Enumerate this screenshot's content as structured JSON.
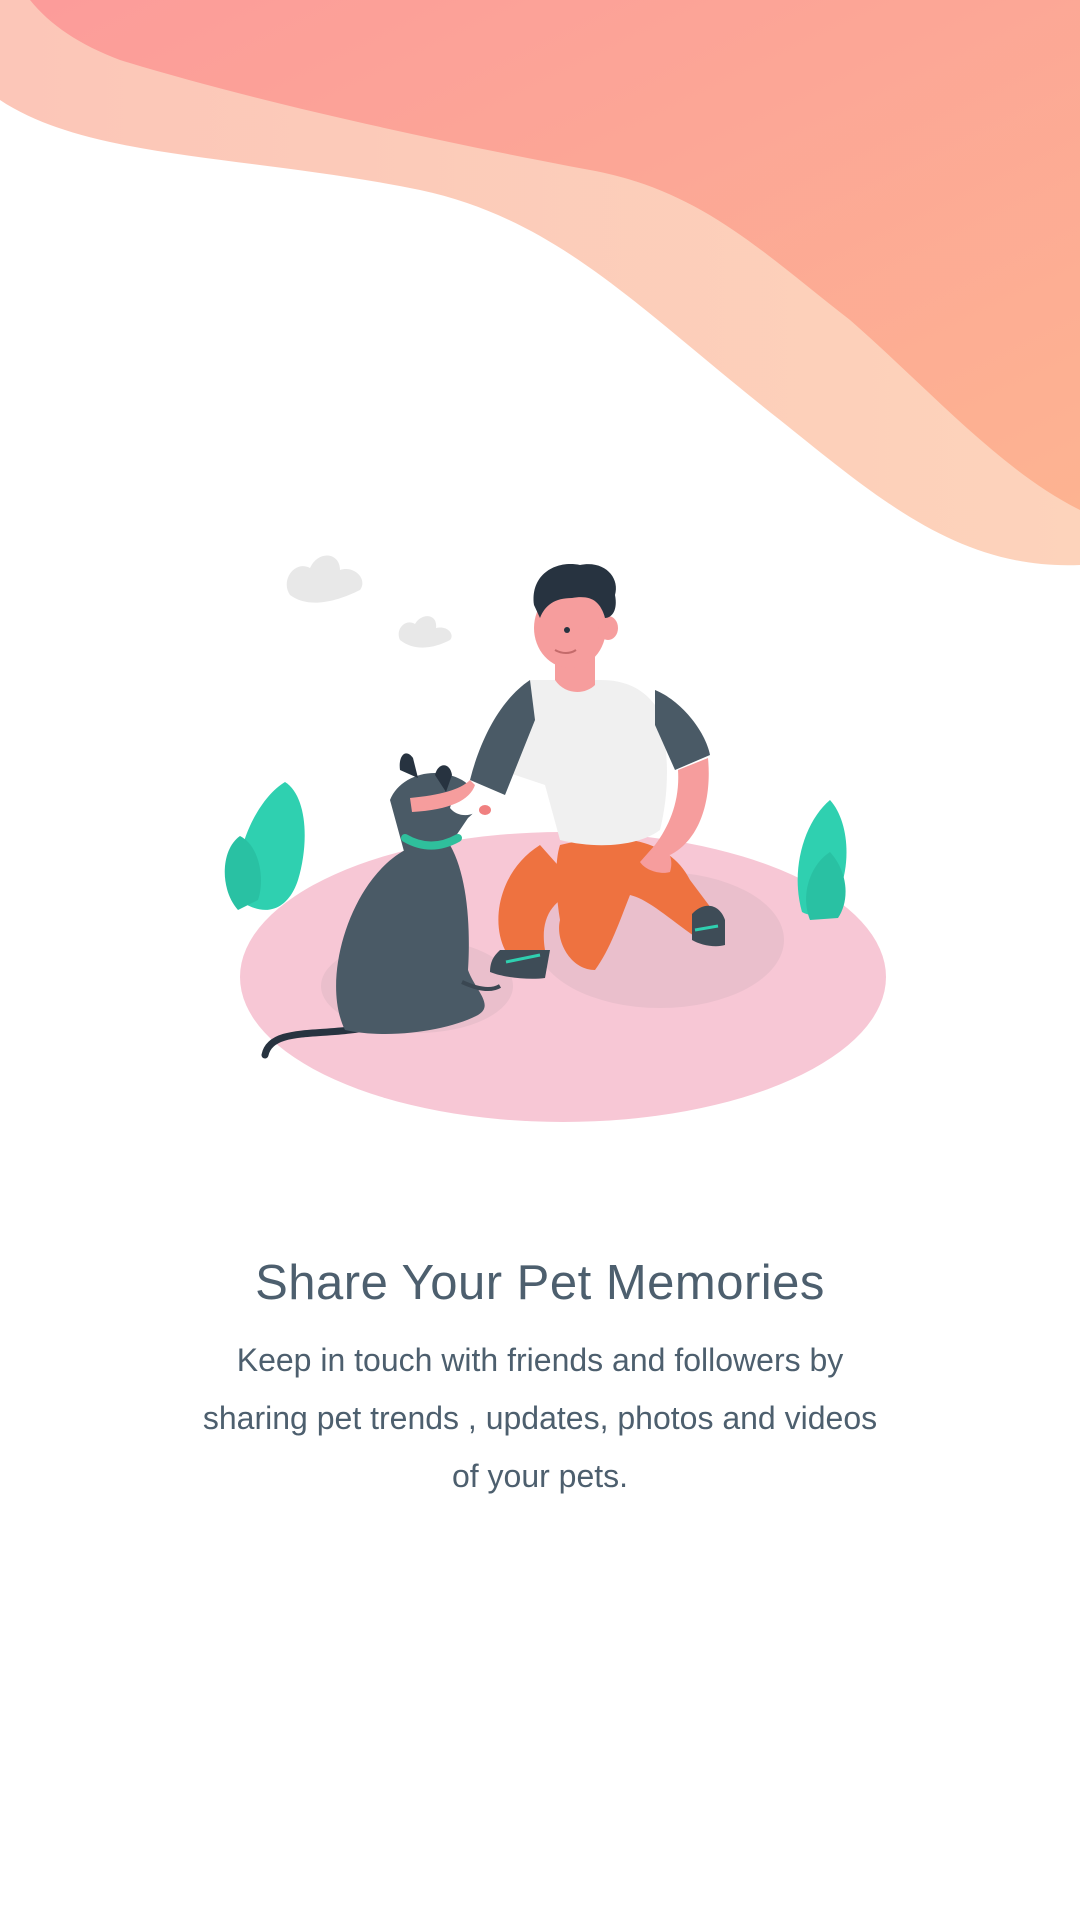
{
  "onboarding": {
    "title": "Share Your Pet Memories",
    "description": "Keep in touch with friends and followers by sharing pet trends , updates, photos and videos of your pets."
  },
  "theme": {
    "wave_primary": "#fbb49f",
    "wave_secondary": "#fdd2bd",
    "ground": "#f7c7d5",
    "text": "#4d5f6e"
  },
  "illustration": {
    "semantic": "person-petting-dog-illustration"
  }
}
